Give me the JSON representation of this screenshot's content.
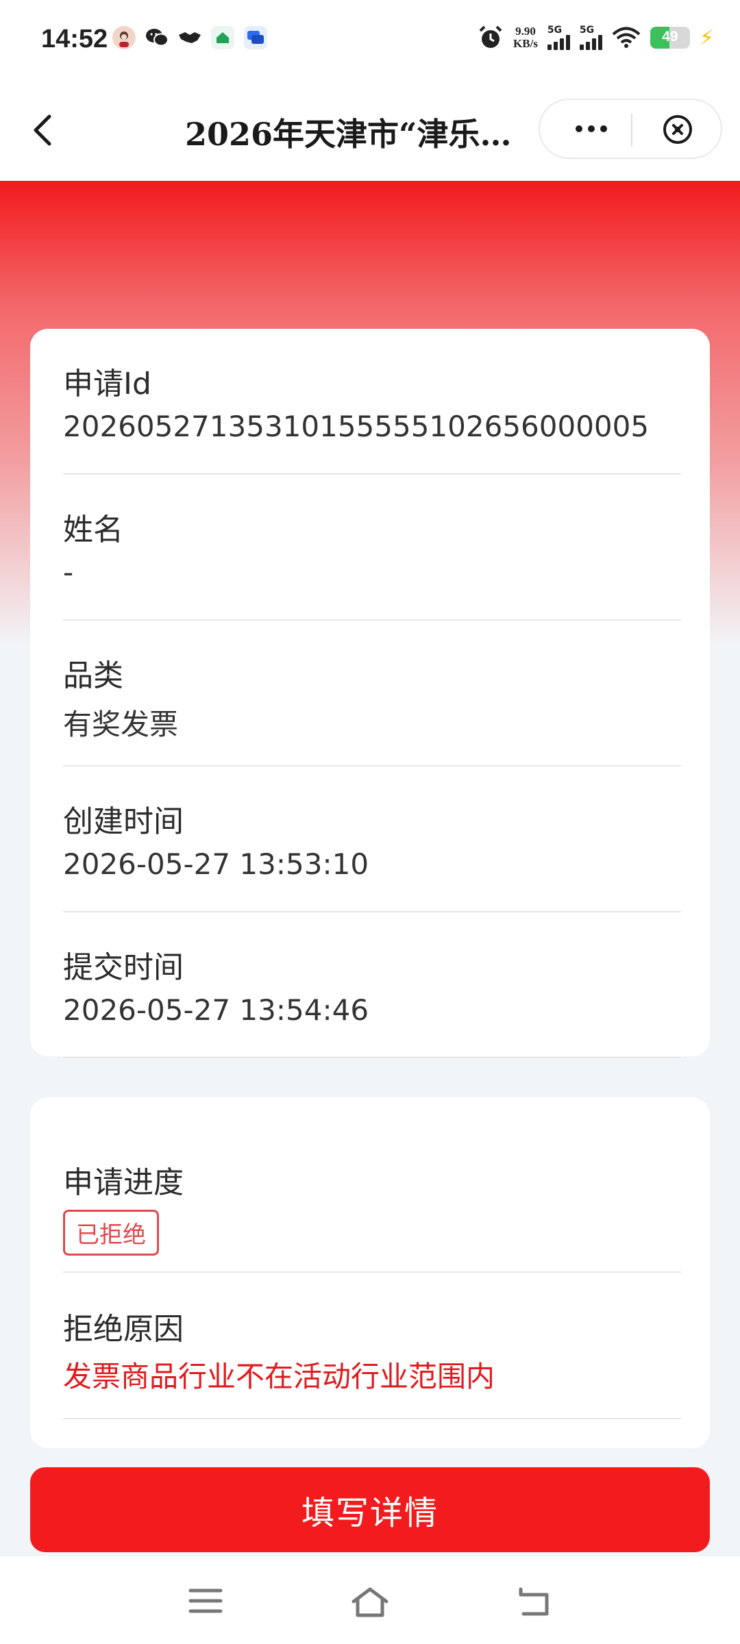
{
  "status_bar": {
    "time": "14:52",
    "net_speed_value": "9.90",
    "net_speed_unit": "KB/s",
    "signal1_label": "5G",
    "signal2_label": "5G",
    "battery_level": "49",
    "icons": [
      "avatar-app-icon",
      "wechat-icon",
      "handshake-icon",
      "home-app-icon",
      "chat-app-icon",
      "alarm-icon",
      "wifi-icon",
      "battery-icon",
      "charging-icon"
    ]
  },
  "nav": {
    "title": "2026年天津市“津乐…",
    "icons": [
      "back-icon",
      "more-icon",
      "close-circle-icon"
    ]
  },
  "details": {
    "fields": [
      {
        "label": "申请Id",
        "value": "20260527135310155555102656000005"
      },
      {
        "label": "姓名",
        "value": "-"
      },
      {
        "label": "品类",
        "value": "有奖发票"
      },
      {
        "label": "创建时间",
        "value": "2026-05-27 13:53:10"
      },
      {
        "label": "提交时间",
        "value": "2026-05-27 13:54:46"
      }
    ]
  },
  "progress": {
    "label": "申请进度",
    "status": "已拒绝",
    "reason_label": "拒绝原因",
    "reason": "发票商品行业不在活动行业范围内"
  },
  "action": {
    "button_label": "填写详情"
  },
  "colors": {
    "brand_red": "#f21b1e",
    "reject_red": "#e11b1f",
    "tag_red": "#e0484c",
    "page_bg": "#f2f5f8"
  }
}
